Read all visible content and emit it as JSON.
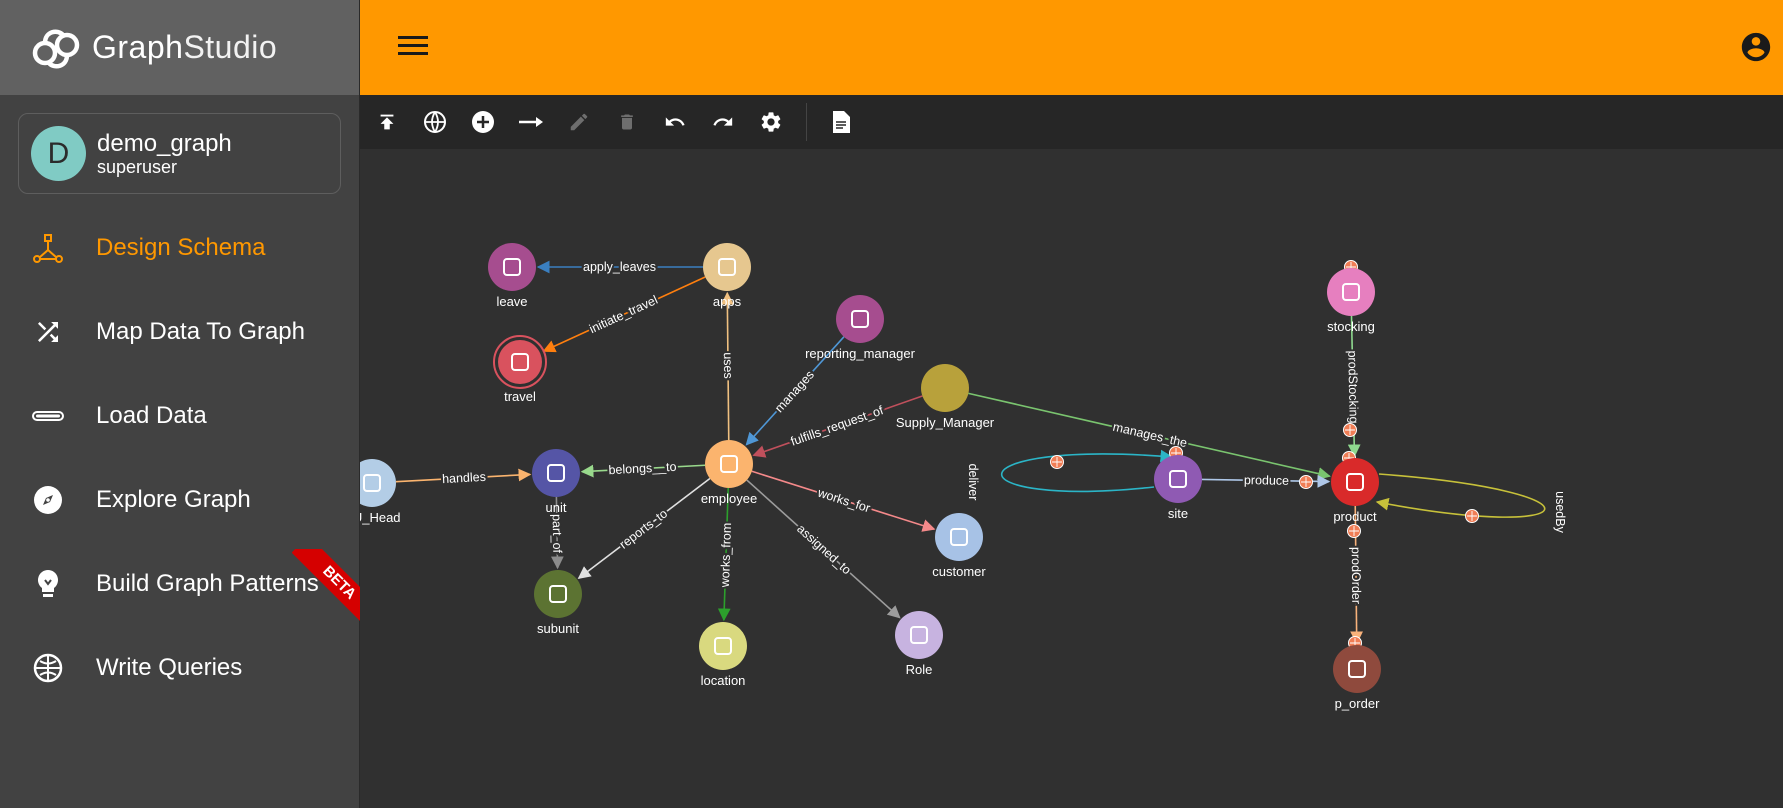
{
  "app": {
    "logo_part1": "Graph",
    "logo_part2": "Studio"
  },
  "graph": {
    "avatar_letter": "D",
    "name": "demo_graph",
    "user": "superuser"
  },
  "sidebar": {
    "items": [
      {
        "label": "Design Schema",
        "icon": "schema-icon",
        "active": true
      },
      {
        "label": "Map Data To Graph",
        "icon": "shuffle-icon",
        "active": false
      },
      {
        "label": "Load Data",
        "icon": "load-bar-icon",
        "active": false
      },
      {
        "label": "Explore Graph",
        "icon": "compass-icon",
        "active": false
      },
      {
        "label": "Build Graph Patterns",
        "icon": "lightbulb-icon",
        "active": false
      },
      {
        "label": "Write Queries",
        "icon": "query-globe-icon",
        "active": false
      }
    ],
    "beta_badge": "BETA"
  },
  "toolbar": {
    "tools": [
      "publish-icon",
      "globe-icon",
      "add-vertex-icon",
      "add-edge-icon",
      "edit-icon",
      "delete-icon",
      "undo-icon",
      "redo-icon",
      "settings-icon",
      "document-icon"
    ]
  },
  "colors": {
    "accent": "#ff9800",
    "sidebar_bg": "#424242",
    "canvas_bg": "#303030"
  },
  "schema": {
    "vertices": [
      {
        "id": "leave",
        "label": "leave",
        "color": "#a64d8f"
      },
      {
        "id": "apps",
        "label": "apps",
        "color": "#e6c78f"
      },
      {
        "id": "travel",
        "label": "travel",
        "color": "#d9525e"
      },
      {
        "id": "reporting_manager",
        "label": "reporting_manager",
        "color": "#a64d8f"
      },
      {
        "id": "Supply_Manager",
        "label": "Supply_Manager",
        "color": "#b8a13b"
      },
      {
        "id": "DU_Head",
        "label": "DU_Head",
        "color": "#b3cde6"
      },
      {
        "id": "unit",
        "label": "unit",
        "color": "#5555a6"
      },
      {
        "id": "employee",
        "label": "employee",
        "color": "#fbb46e"
      },
      {
        "id": "subunit",
        "label": "subunit",
        "color": "#5c7332"
      },
      {
        "id": "location",
        "label": "location",
        "color": "#d9d97f"
      },
      {
        "id": "Role",
        "label": "Role",
        "color": "#c7b3e0"
      },
      {
        "id": "customer",
        "label": "customer",
        "color": "#a7c2e6"
      },
      {
        "id": "stocking",
        "label": "stocking",
        "color": "#e67fbf"
      },
      {
        "id": "site",
        "label": "site",
        "color": "#8f5ab3"
      },
      {
        "id": "product",
        "label": "product",
        "color": "#d92a2a"
      },
      {
        "id": "p_order",
        "label": "p_order",
        "color": "#8f4a3d"
      }
    ],
    "edges": [
      {
        "label": "apply_leaves",
        "from": "apps",
        "to": "leave"
      },
      {
        "label": "initiate_travel",
        "from": "apps",
        "to": "travel"
      },
      {
        "label": "uses",
        "from": "employee",
        "to": "apps"
      },
      {
        "label": "manages",
        "from": "reporting_manager",
        "to": "employee"
      },
      {
        "label": "fulfills_request_of",
        "from": "Supply_Manager",
        "to": "employee"
      },
      {
        "label": "manages_the",
        "from": "Supply_Manager",
        "to": "product"
      },
      {
        "label": "handles",
        "from": "DU_Head",
        "to": "unit"
      },
      {
        "label": "belongs__to",
        "from": "employee",
        "to": "unit"
      },
      {
        "label": "part_of",
        "from": "unit",
        "to": "subunit"
      },
      {
        "label": "reports_to",
        "from": "employee",
        "to": "subunit"
      },
      {
        "label": "works_from",
        "from": "employee",
        "to": "location"
      },
      {
        "label": "assigned_to",
        "from": "employee",
        "to": "Role"
      },
      {
        "label": "works_for",
        "from": "employee",
        "to": "customer"
      },
      {
        "label": "prodStocking",
        "from": "stocking",
        "to": "product"
      },
      {
        "label": "deliver",
        "from": "site",
        "to": "site"
      },
      {
        "label": "produce",
        "from": "site",
        "to": "product"
      },
      {
        "label": "usedBy",
        "from": "product",
        "to": "product"
      },
      {
        "label": "prodOrder",
        "from": "product",
        "to": "p_order"
      }
    ]
  }
}
